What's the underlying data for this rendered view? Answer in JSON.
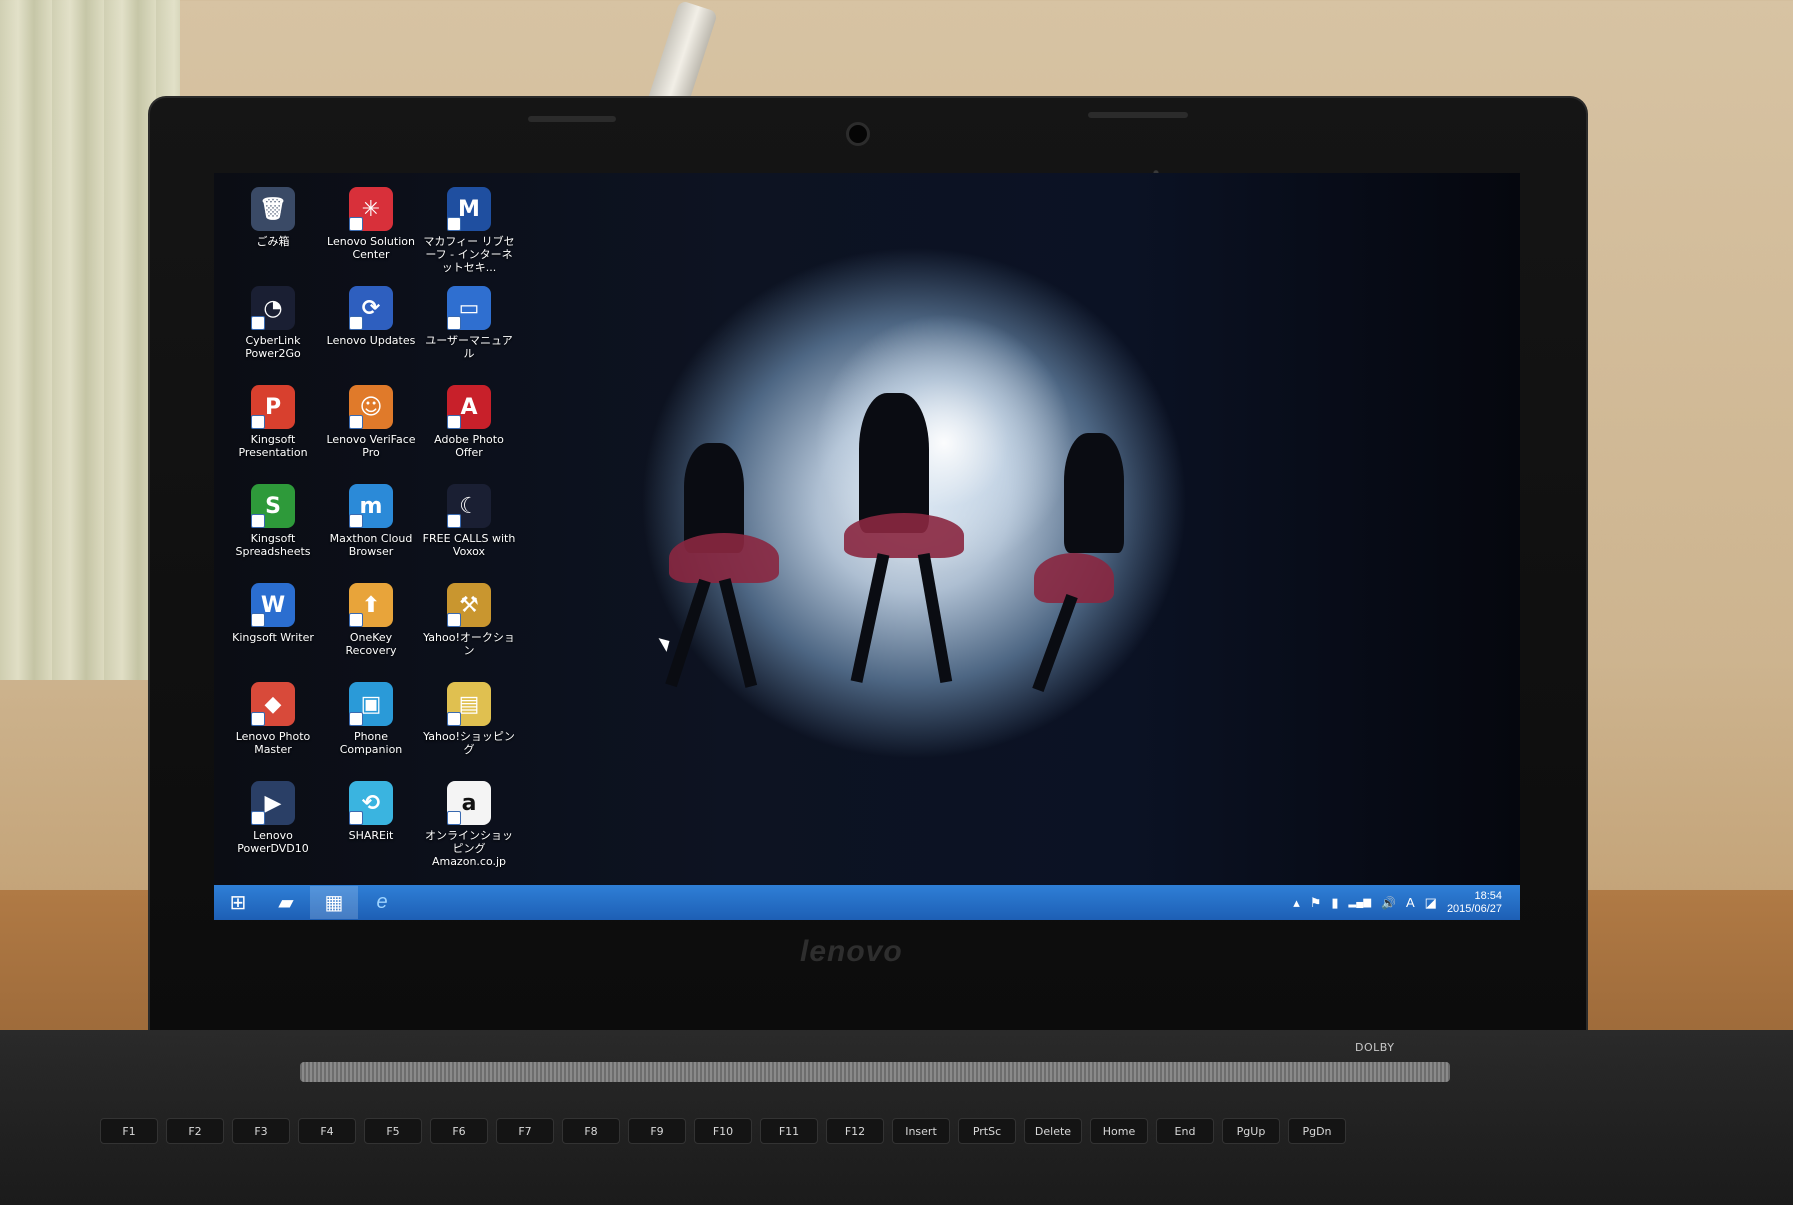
{
  "desktop": {
    "icons": [
      {
        "label": "ごみ箱",
        "glyph": "🗑",
        "color": "#3a4a66",
        "icon": "recycle-bin-icon"
      },
      {
        "label": "Lenovo Solution Center",
        "glyph": "✳",
        "color": "#d8303a",
        "icon": "lenovo-solution-center-icon"
      },
      {
        "label": "マカフィー リブセーフ - インターネットセキ...",
        "glyph": "M",
        "color": "#1f4fa0",
        "icon": "mcafee-icon"
      },
      {
        "label": "CyberLink Power2Go",
        "glyph": "◔",
        "color": "#1a1f33",
        "icon": "cyberlink-power2go-icon"
      },
      {
        "label": "Lenovo Updates",
        "glyph": "⟳",
        "color": "#2e5fbf",
        "icon": "lenovo-updates-icon"
      },
      {
        "label": "ユーザーマニュアル",
        "glyph": "▭",
        "color": "#2f6fd0",
        "icon": "user-manual-icon"
      },
      {
        "label": "Kingsoft Presentation",
        "glyph": "P",
        "color": "#d8402e",
        "icon": "kingsoft-presentation-icon"
      },
      {
        "label": "Lenovo VeriFace Pro",
        "glyph": "☺",
        "color": "#e07a2a",
        "icon": "lenovo-veriface-icon"
      },
      {
        "label": "Adobe Photo Offer",
        "glyph": "A",
        "color": "#c8202a",
        "icon": "adobe-photo-icon"
      },
      {
        "label": "Kingsoft Spreadsheets",
        "glyph": "S",
        "color": "#2e9a3a",
        "icon": "kingsoft-spreadsheets-icon"
      },
      {
        "label": "Maxthon Cloud Browser",
        "glyph": "m",
        "color": "#2b8ad8",
        "icon": "maxthon-browser-icon"
      },
      {
        "label": "FREE CALLS with Voxox",
        "glyph": "☾",
        "color": "#1a1f33",
        "icon": "voxox-icon"
      },
      {
        "label": "Kingsoft Writer",
        "glyph": "W",
        "color": "#2b6ed0",
        "icon": "kingsoft-writer-icon"
      },
      {
        "label": "OneKey Recovery",
        "glyph": "⬆",
        "color": "#e8a43a",
        "icon": "onekey-recovery-icon"
      },
      {
        "label": "Yahoo!オークション",
        "glyph": "⚒",
        "color": "#c9962f",
        "icon": "yahoo-auction-icon"
      },
      {
        "label": "Lenovo Photo Master",
        "glyph": "◆",
        "color": "#d84a3a",
        "icon": "lenovo-photo-master-icon"
      },
      {
        "label": "Phone Companion",
        "glyph": "▣",
        "color": "#2a9ad8",
        "icon": "phone-companion-icon"
      },
      {
        "label": "Yahoo!ショッピング",
        "glyph": "▤",
        "color": "#e0c050",
        "icon": "yahoo-shopping-icon"
      },
      {
        "label": "Lenovo PowerDVD10",
        "glyph": "▶",
        "color": "#2a3f66",
        "icon": "powerdvd-icon"
      },
      {
        "label": "SHAREit",
        "glyph": "⟲",
        "color": "#3ab4e0",
        "icon": "shareit-icon"
      },
      {
        "label": "オンラインショッピング Amazon.co.jp",
        "glyph": "a",
        "color": "#f4f4f4",
        "icon": "amazon-icon"
      }
    ]
  },
  "taskbar": {
    "buttons": [
      {
        "glyph": "⊞",
        "icon": "windows-start-icon",
        "active": false
      },
      {
        "glyph": "▰",
        "icon": "file-explorer-icon",
        "active": false
      },
      {
        "glyph": "▦",
        "icon": "desktop-app-icon",
        "active": true
      },
      {
        "glyph": "e",
        "icon": "internet-explorer-icon",
        "active": false
      }
    ],
    "tray": {
      "chevron": "▴",
      "flag": "⚑",
      "network": "▮",
      "signal": "▂▄▆",
      "volume": "🔊",
      "ime": "A",
      "action": "◪",
      "time": "18:54",
      "date": "2015/06/27"
    }
  },
  "laptop": {
    "brand": "lenovo",
    "dolby": "DOLBY",
    "keys": [
      "F1",
      "F2",
      "F3",
      "F4",
      "F5",
      "F6",
      "F7",
      "F8",
      "F9",
      "F10",
      "F11",
      "F12",
      "Insert",
      "PrtSc",
      "Delete",
      "Home",
      "End",
      "PgUp",
      "PgDn"
    ]
  },
  "colors": {
    "taskbar": "#1d5fb5",
    "bezel": "#0c0c0c"
  }
}
